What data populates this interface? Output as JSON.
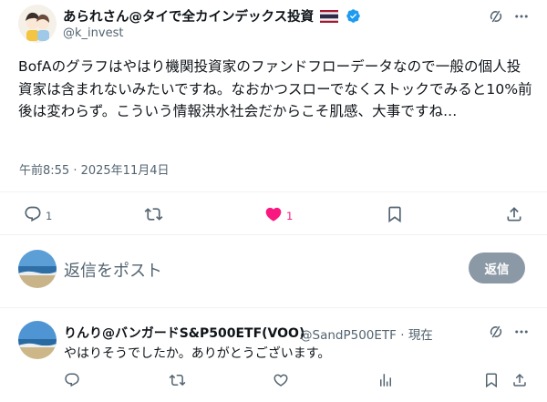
{
  "main_post": {
    "author_name": "あられさん@タイで全カインデックス投資",
    "author_handle": "@k_invest",
    "body": "BofAのグラフはやはり機関投資家のファンドフローデータなので一般の個人投資家は含まれないみたいですね。なおかつスローでなくストックでみると10%前後は変わらず。こういう情報洪水社会だからこそ肌感、大事ですね...",
    "timestamp": "午前8:55 · 2025年11月4日",
    "reply_count": "1",
    "like_count": "1"
  },
  "composer": {
    "placeholder": "返信をポスト",
    "reply_button_label": "返信"
  },
  "reply_post": {
    "author_name": "りんり@バンガードS&P500ETF(VOO)",
    "author_handle": "@SandP500ETF",
    "separator": "·",
    "time": "現在",
    "body": "やはりそうでしたか。ありがとうございます。"
  },
  "colors": {
    "like_pink": "#f91880",
    "verified_blue": "#1d9bf0",
    "muted": "#536471",
    "reply_button_bg": "#8b98a5"
  },
  "icons": [
    "avatar-illustration",
    "verified-badge-icon",
    "thailand-flag-icon",
    "grok-icon",
    "more-icon",
    "reply-icon",
    "repost-icon",
    "like-icon",
    "bookmark-icon",
    "share-icon",
    "views-icon"
  ]
}
